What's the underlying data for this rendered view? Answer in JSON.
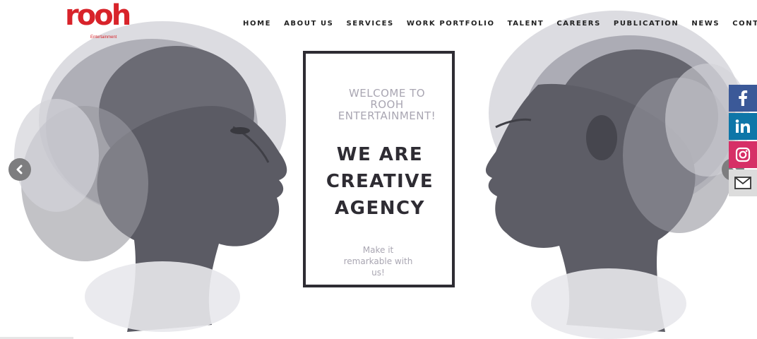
{
  "brand": {
    "logo_text": "rooh",
    "logo_sub": "Entertainment",
    "color": "#d8232a"
  },
  "nav": {
    "items": [
      "HOME",
      "ABOUT US",
      "SERVICES",
      "WORK PORTFOLIO",
      "TALENT",
      "CAREERS",
      "PUBLICATION",
      "NEWS",
      "CONTACT"
    ]
  },
  "hero": {
    "welcome_lines": [
      "WELCOME TO",
      "ROOH",
      "ENTERTAINMENT!"
    ],
    "headline_lines": [
      "WE ARE",
      "CREATIVE",
      "AGENCY"
    ],
    "tagline_lines": [
      "Make it",
      "remarkable with",
      "us!"
    ]
  },
  "slider": {
    "prev_icon": "chevron-left-icon",
    "next_icon": "chevron-right-icon"
  },
  "social": {
    "items": [
      {
        "name": "facebook",
        "icon": "facebook-icon",
        "color": "#3b5998"
      },
      {
        "name": "linkedin",
        "icon": "linkedin-icon",
        "color": "#0e76a8"
      },
      {
        "name": "instagram",
        "icon": "instagram-icon",
        "color": "#d62f66"
      },
      {
        "name": "mail",
        "icon": "mail-icon",
        "color": "#dcdcdc"
      }
    ]
  },
  "colors": {
    "box_border": "#2e2c33",
    "muted_text": "#a9a6b2",
    "arrow_bg": "#7d7d7f"
  }
}
